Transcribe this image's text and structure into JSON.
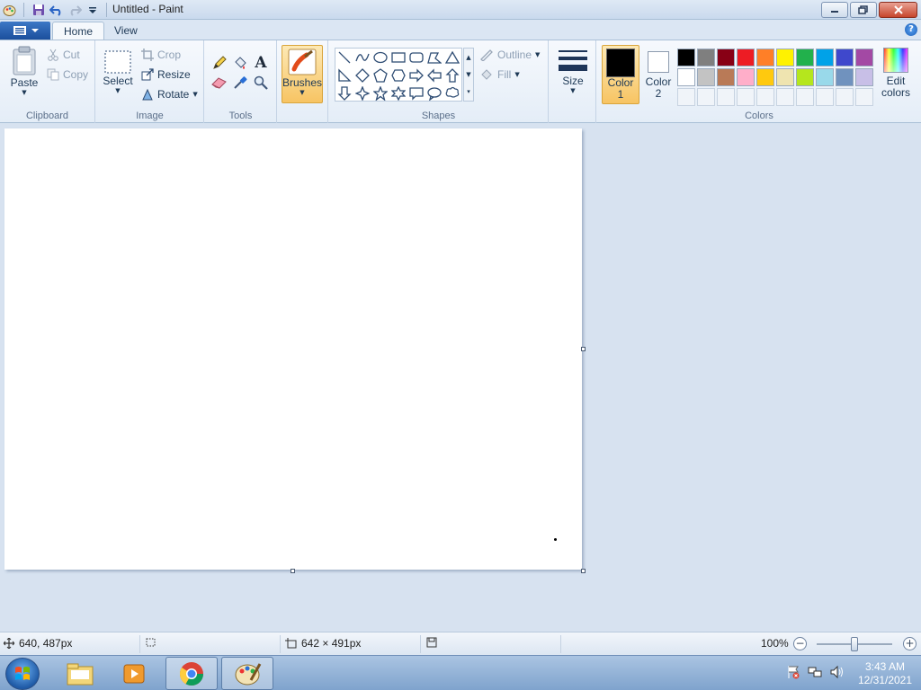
{
  "window": {
    "title": "Untitled - Paint"
  },
  "tabs": [
    {
      "label": "Home"
    },
    {
      "label": "View"
    }
  ],
  "ribbon": {
    "clipboard": {
      "label": "Clipboard",
      "paste": "Paste",
      "cut": "Cut",
      "copy": "Copy"
    },
    "image": {
      "label": "Image",
      "select": "Select",
      "crop": "Crop",
      "resize": "Resize",
      "rotate": "Rotate"
    },
    "tools": {
      "label": "Tools"
    },
    "brushes": {
      "label": "Brushes"
    },
    "shapes": {
      "label": "Shapes",
      "outline": "Outline",
      "fill": "Fill"
    },
    "size": {
      "label": "Size"
    },
    "colors": {
      "label": "Colors",
      "color1": "Color 1",
      "color2": "Color 2",
      "edit": "Edit colors",
      "color1_value": "#000000",
      "color2_value": "#ffffff",
      "palette": [
        "#000000",
        "#7f7f7f",
        "#880015",
        "#ed1c24",
        "#ff7f27",
        "#fff200",
        "#22b14c",
        "#00a2e8",
        "#3f48cc",
        "#a349a4",
        "#ffffff",
        "#c3c3c3",
        "#b97a57",
        "#ffaec9",
        "#ffc90e",
        "#efe4b0",
        "#b5e61d",
        "#99d9ea",
        "#7092be",
        "#c8bfe7",
        "#f0f4f9",
        "#f0f4f9",
        "#f0f4f9",
        "#f0f4f9",
        "#f0f4f9",
        "#f0f4f9",
        "#f0f4f9",
        "#f0f4f9",
        "#f0f4f9",
        "#f0f4f9"
      ]
    }
  },
  "status": {
    "cursor_pos": "640, 487px",
    "image_size": "642 × 491px",
    "zoom": "100%"
  },
  "taskbar": {
    "time": "3:43 AM",
    "date": "12/31/2021"
  }
}
